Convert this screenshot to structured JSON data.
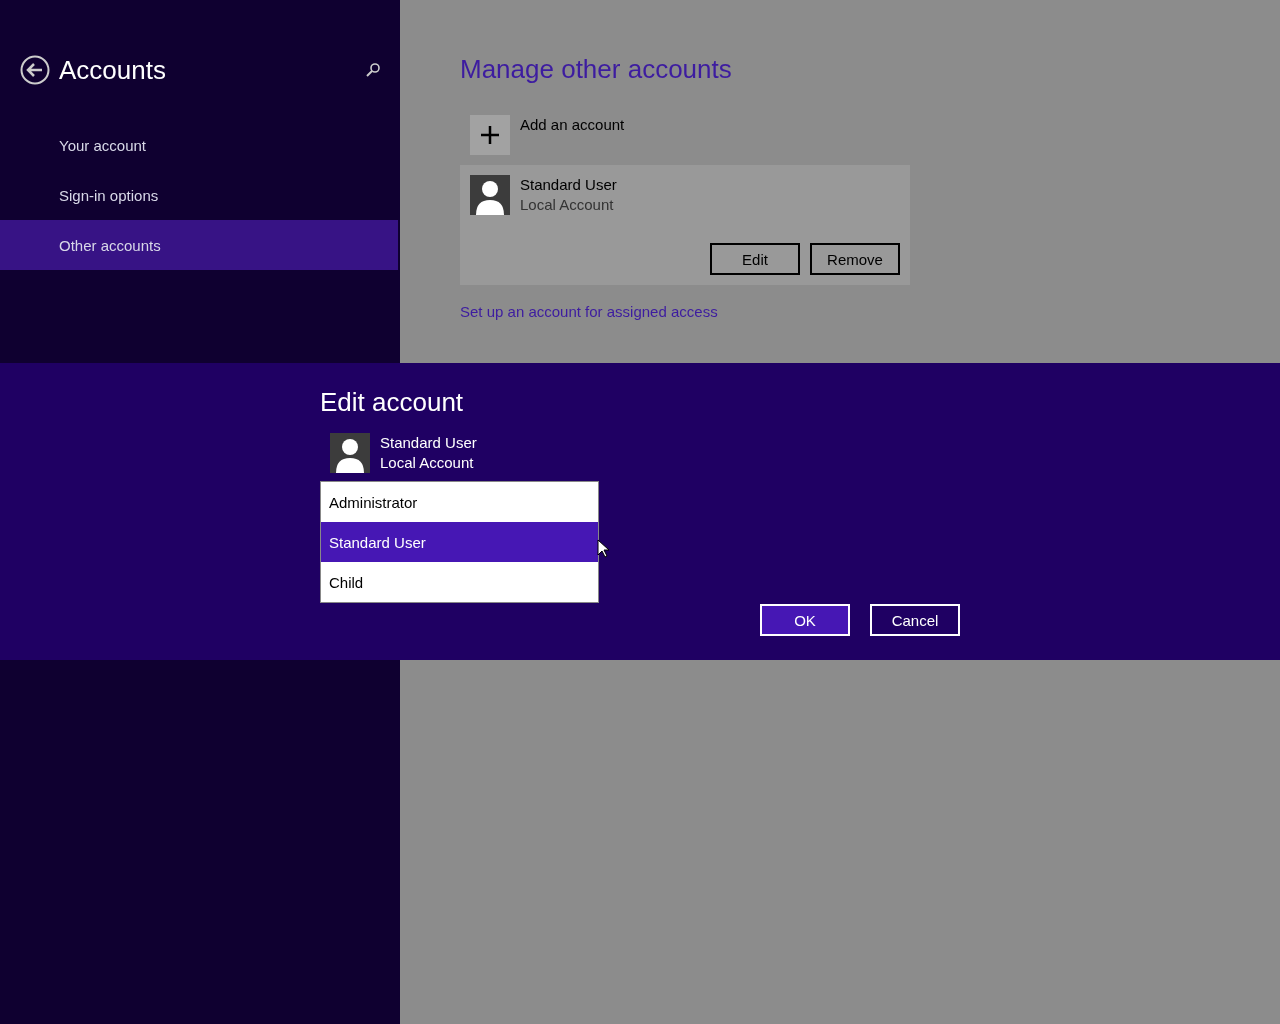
{
  "sidebar": {
    "title": "Accounts",
    "items": [
      {
        "label": "Your account",
        "selected": false
      },
      {
        "label": "Sign-in options",
        "selected": false
      },
      {
        "label": "Other accounts",
        "selected": true
      }
    ]
  },
  "main": {
    "heading": "Manage other accounts",
    "add_account": "Add an account",
    "account": {
      "name": "Standard User",
      "type": "Local Account"
    },
    "buttons": [
      "Edit",
      "Remove"
    ],
    "link": "Set up an account for assigned access"
  },
  "dialog": {
    "title": "Edit account",
    "account": {
      "name": "Standard User",
      "type": "Local Account"
    },
    "options": [
      {
        "label": "Administrator",
        "selected": false
      },
      {
        "label": "Standard User",
        "selected": true
      },
      {
        "label": "Child",
        "selected": false
      }
    ],
    "buttons": [
      {
        "label": "OK",
        "kind": "primary"
      },
      {
        "label": "Cancel",
        "kind": "secondary"
      }
    ]
  }
}
